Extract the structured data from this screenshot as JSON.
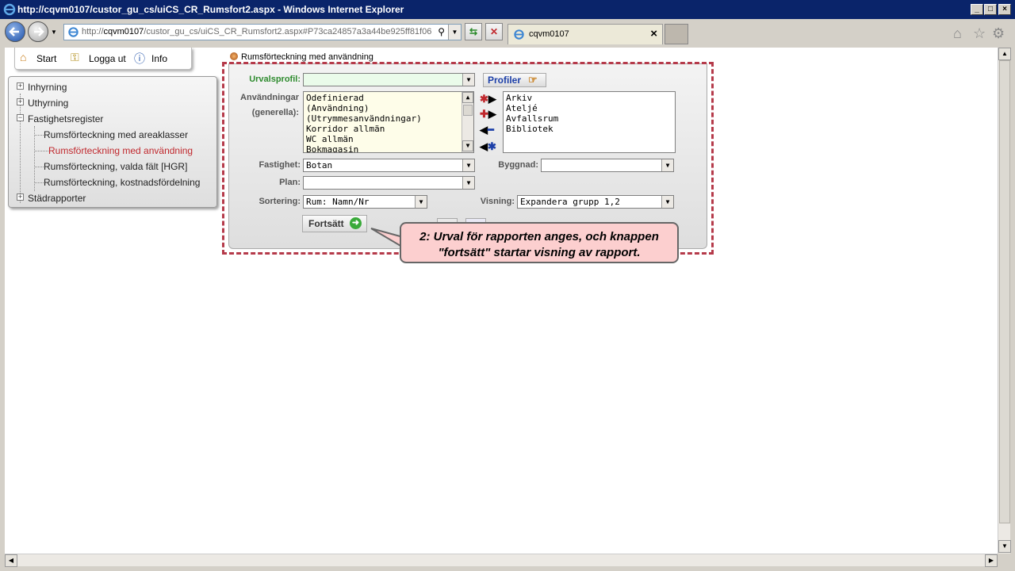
{
  "window": {
    "title": "http://cqvm0107/custor_gu_cs/uiCS_CR_Rumsfort2.aspx - Windows Internet Explorer",
    "controls": [
      "_",
      "□",
      "×"
    ]
  },
  "browser": {
    "address_prefix": "http://",
    "address_host": "cqvm0107",
    "address_path": "/custor_gu_cs/uiCS_CR_Rumsfort2.aspx#P73ca24857a3a44be925ff81f06",
    "tab_title": "cqvm0107",
    "tab_close": "×"
  },
  "top_menu": {
    "start": "Start",
    "logout": "Logga ut",
    "info": "Info"
  },
  "tree": {
    "items": [
      {
        "label": "Inhyrning",
        "expander": "+"
      },
      {
        "label": "Uthyrning",
        "expander": "+"
      },
      {
        "label": "Fastighetsregister",
        "expander": "−"
      },
      {
        "label": "Rumsförteckning med areaklasser"
      },
      {
        "label": "Rumsförteckning med användning"
      },
      {
        "label": "Rumsförteckning, valda fält [HGR]"
      },
      {
        "label": "Rumsförteckning, kostnadsfördelning"
      },
      {
        "label": "Städrapporter",
        "expander": "+"
      }
    ]
  },
  "form": {
    "breadcrumb": "Rumsförteckning med användning",
    "profile_label": "Urvalsprofil:",
    "profile_value": "",
    "profiles_button": "Profiler",
    "usage_label_1": "Användningar",
    "usage_label_2": "(generella):",
    "usage_available": [
      "Odefinierad",
      "(Användning)",
      "(Utrymmesanvändningar)",
      "Korridor allmän",
      "WC allmän",
      "Bokmagasin"
    ],
    "usage_selected": [
      "Arkiv",
      "Ateljé",
      "Avfallsrum",
      "Bibliotek"
    ],
    "fastighet_label": "Fastighet:",
    "fastighet_value": "Botan",
    "byggnad_label": "Byggnad:",
    "byggnad_value": "",
    "plan_label": "Plan:",
    "plan_value": "",
    "sortering_label": "Sortering:",
    "sortering_value": "Rum: Namn/Nr",
    "visning_label": "Visning:",
    "visning_value": "Expandera grupp 1,2",
    "continue_button": "Fortsätt"
  },
  "callout": {
    "line1": "2: Urval för rapporten anges, och knappen",
    "line2": "\"fortsätt\" startar visning av rapport."
  },
  "colors": {
    "titlebar": "#0a246a",
    "active_tree_item": "#c0282d",
    "profile_label": "#2e8b2e",
    "callout_bg": "#fccfcf",
    "dash_border": "#b53a4a"
  }
}
